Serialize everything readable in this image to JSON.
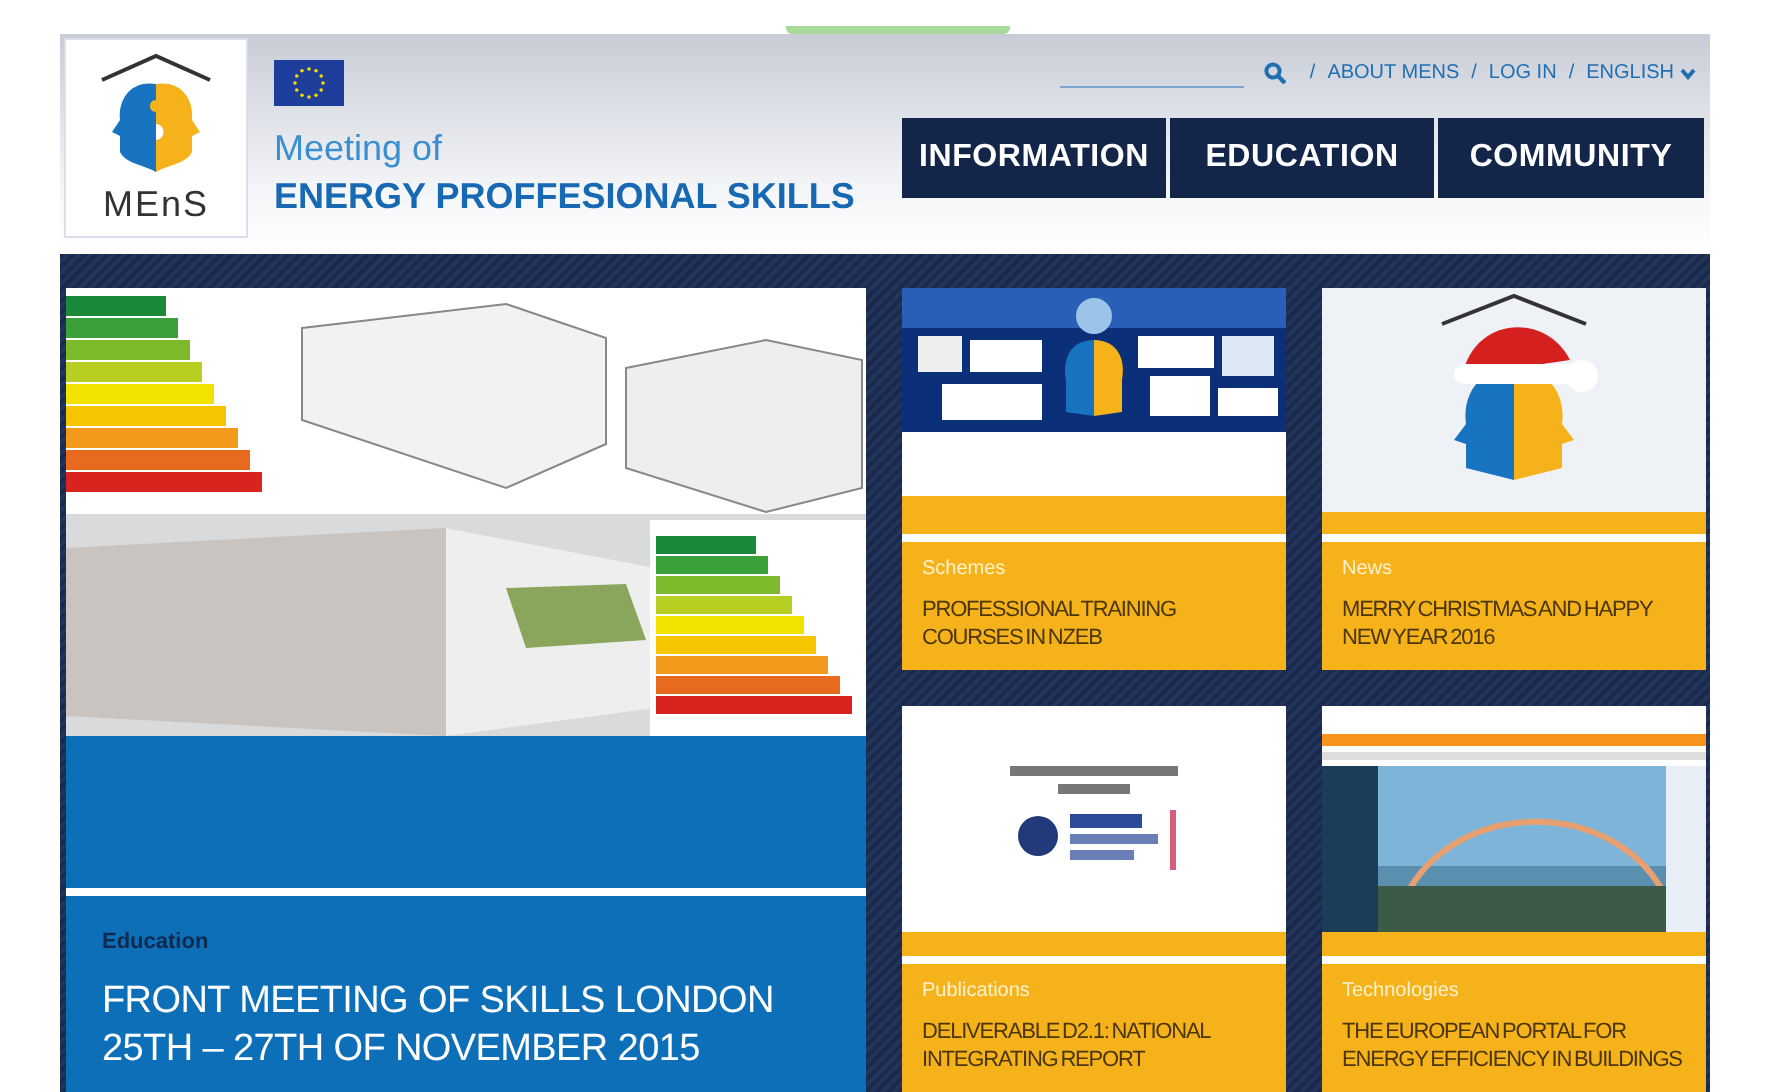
{
  "header": {
    "logo_text": "MEnS",
    "title_line1": "Meeting of",
    "title_line2": "ENERGY PROFFESIONAL SKILLS",
    "top_links": [
      {
        "separator": "/",
        "label": "ABOUT MENS",
        "kind": "link"
      },
      {
        "separator": "/",
        "label": "LOG IN",
        "kind": "link"
      },
      {
        "separator": "/",
        "label": "ENGLISH",
        "kind": "dropdown"
      }
    ],
    "nav": [
      "INFORMATION",
      "EDUCATION",
      "COMMUNITY"
    ]
  },
  "feature": {
    "category": "Education",
    "title": "FRONT MEETING OF SKILLS LONDON 25TH – 27TH OF NOVEMBER 2015"
  },
  "cards": [
    {
      "category": "Schemes",
      "title": "PROFESSIONAL TRAINING COURSES IN NZEB"
    },
    {
      "category": "News",
      "title": "MERRY CHRISTMAS AND HAPPY NEW YEAR 2016"
    },
    {
      "category": "Publications",
      "title": "DELIVERABLE D2.1: NATIONAL INTEGRATING REPORT"
    },
    {
      "category": "Technologies",
      "title": "THE EUROPEAN PORTAL FOR ENERGY EFFICIENCY IN BUILDINGS"
    }
  ]
}
